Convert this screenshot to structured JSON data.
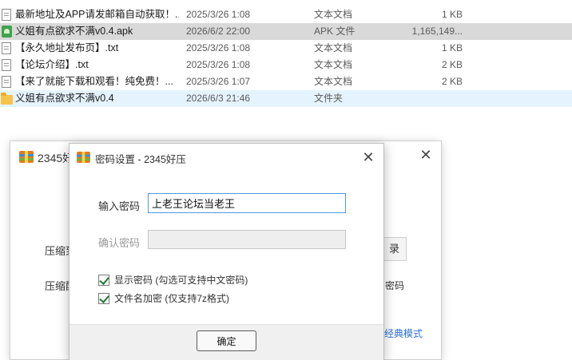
{
  "explorer": {
    "files": [
      {
        "icon": "text-file-icon",
        "name": "最新地址及APP请发邮箱自动获取！...",
        "date": "2025/3/26 1:08",
        "type": "文本文档",
        "size": "1 KB",
        "state": "normal"
      },
      {
        "icon": "apk-file-icon",
        "name": "义姐有点欲求不满v0.4.apk",
        "date": "2026/6/2 22:00",
        "type": "APK 文件",
        "size": "1,165,149...",
        "state": "selected"
      },
      {
        "icon": "text-file-icon",
        "name": "【永久地址发布页】.txt",
        "date": "2025/3/26 1:08",
        "type": "文本文档",
        "size": "1 KB",
        "state": "normal"
      },
      {
        "icon": "text-file-icon",
        "name": "【论坛介绍】.txt",
        "date": "2025/3/26 1:08",
        "type": "文本文档",
        "size": "2 KB",
        "state": "normal"
      },
      {
        "icon": "text-file-icon",
        "name": "【来了就能下载和观看！纯免费！...",
        "date": "2025/3/26 1:07",
        "type": "文本文档",
        "size": "2 KB",
        "state": "normal"
      },
      {
        "icon": "folder-icon",
        "name": "义姐有点欲求不满v0.4",
        "date": "2026/6/3 21:46",
        "type": "文件夹",
        "size": "",
        "state": "hover"
      }
    ]
  },
  "background_window": {
    "title": "2345好",
    "close_glyph": "✕",
    "compress_label_1": "压缩到",
    "compress_label_2": "压缩配",
    "browse_button": "录",
    "right_text": "密码",
    "classic_mode_link": "经典模式"
  },
  "dialog": {
    "title": "密码设置 - 2345好压",
    "close_glyph": "✕",
    "password_label": "输入密码",
    "password_value": "上老王论坛当老王",
    "confirm_label": "确认密码",
    "confirm_value": "",
    "show_password": {
      "label": "显示密码 (勾选可支持中文密码)",
      "checked": true
    },
    "encrypt_filenames": {
      "label": "文件名加密  (仅支持7z格式)",
      "checked": true
    },
    "ok_button": "确定"
  },
  "colors": {
    "selected_row": "#d9d9d9",
    "hover_row": "#cce8ff",
    "input_focus_border": "#4f9be0",
    "link": "#2b6fd6",
    "checkmark": "#1f7a2e"
  }
}
